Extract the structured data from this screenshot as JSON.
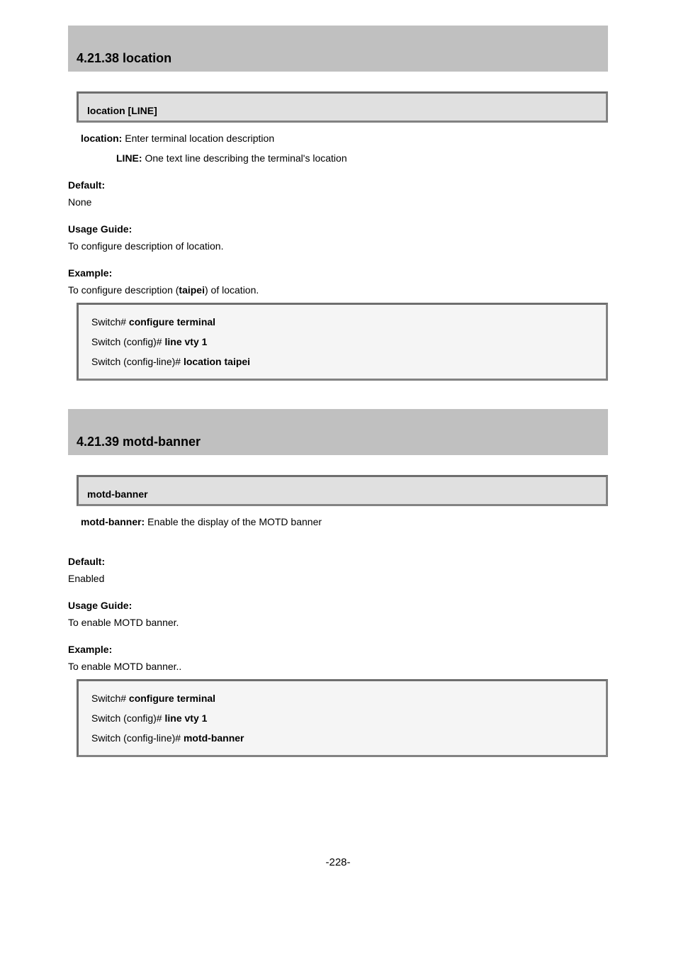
{
  "sec1": {
    "title": "4.21.38 location",
    "syntax": "location [LINE]",
    "param_key": "location:",
    "param_desc": " Enter terminal location description",
    "line_key": "LINE:",
    "line_desc": " One text line describing the terminal's location",
    "default_label": "Default:",
    "default_value": "None",
    "usage_label": "Usage Guide:",
    "usage_value": "To configure description of location.",
    "example_label": "Example:",
    "example_text_pre": "To configure description (",
    "example_text_bold": "taipei",
    "example_text_post": ") of location.",
    "code": [
      {
        "prompt": "Switch# ",
        "cmd": "configure terminal"
      },
      {
        "prompt": "Switch (config)# ",
        "cmd": "line vty 1"
      },
      {
        "prompt": "Switch (config-line)# ",
        "cmd": "location taipei"
      }
    ]
  },
  "sec2": {
    "title": "4.21.39 motd-banner",
    "syntax": "motd-banner",
    "param_key": "motd-banner:",
    "param_desc": " Enable the display of the MOTD banner",
    "default_label": "Default:",
    "default_value": "Enabled",
    "usage_label": "Usage Guide:",
    "usage_value": "To enable MOTD banner.",
    "example_label": "Example:",
    "example_value": "To enable MOTD banner..",
    "code": [
      {
        "prompt": "Switch# ",
        "cmd": "configure terminal"
      },
      {
        "prompt": "Switch (config)# ",
        "cmd": "line vty 1"
      },
      {
        "prompt": "Switch (config-line)# ",
        "cmd": "motd-banner"
      }
    ]
  },
  "page_no": "-228-"
}
